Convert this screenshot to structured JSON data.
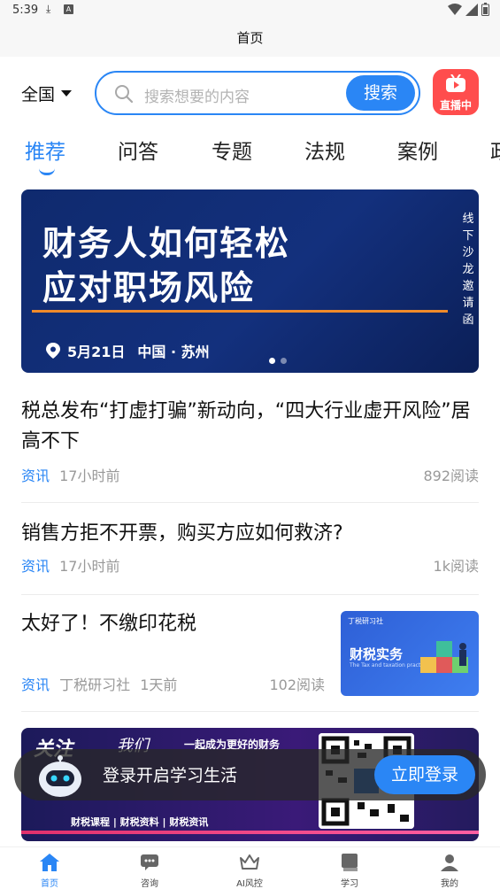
{
  "status_bar": {
    "time": "5:39"
  },
  "title_bar": {
    "title": "首页"
  },
  "search": {
    "region": "全国",
    "placeholder": "搜索想要的内容",
    "button": "搜索",
    "live_label": "直播中"
  },
  "tabs": [
    "推荐",
    "问答",
    "专题",
    "法规",
    "案例",
    "政"
  ],
  "banner": {
    "line1": "财务人如何轻松",
    "line2": "应对职场风险",
    "side_text": [
      "线",
      "下",
      "沙",
      "龙",
      "邀",
      "请",
      "函"
    ],
    "date": "5月21日",
    "place": "中国 · 苏州"
  },
  "articles": [
    {
      "title": "税总发布“打虚打骗”新动向，“四大行业虚开风险”居高不下",
      "category": "资讯",
      "source": "",
      "time": "17小时前",
      "reads": "892阅读"
    },
    {
      "title": "销售方拒不开票，购买方应如何救济?",
      "category": "资讯",
      "source": "",
      "time": "17小时前",
      "reads": "1k阅读"
    },
    {
      "title": "太好了！不缴印花税",
      "category": "资讯",
      "source": "丁税研习社",
      "time": "1天前",
      "reads": "102阅读",
      "thumb_title": "财税实务",
      "thumb_sub": "The Tax and taxation practice",
      "thumb_logo": "丁税研习社"
    }
  ],
  "promo": {
    "follow": "关注",
    "us": "我们",
    "slogan": "一起成为更好的财务",
    "tags": "财税课程 | 财税资料 | 财税资讯"
  },
  "login_bar": {
    "text": "登录开启学习生活",
    "button": "立即登录"
  },
  "bottom_nav": [
    {
      "label": "首页",
      "icon": "home-icon"
    },
    {
      "label": "咨询",
      "icon": "chat-icon"
    },
    {
      "label": "AI风控",
      "icon": "crown-icon"
    },
    {
      "label": "学习",
      "icon": "book-icon"
    },
    {
      "label": "我的",
      "icon": "user-icon"
    }
  ],
  "colors": {
    "accent": "#2a86f5",
    "live": "#ff4d4d",
    "banner_bg": "#13307d",
    "underline": "#f08a2a"
  }
}
